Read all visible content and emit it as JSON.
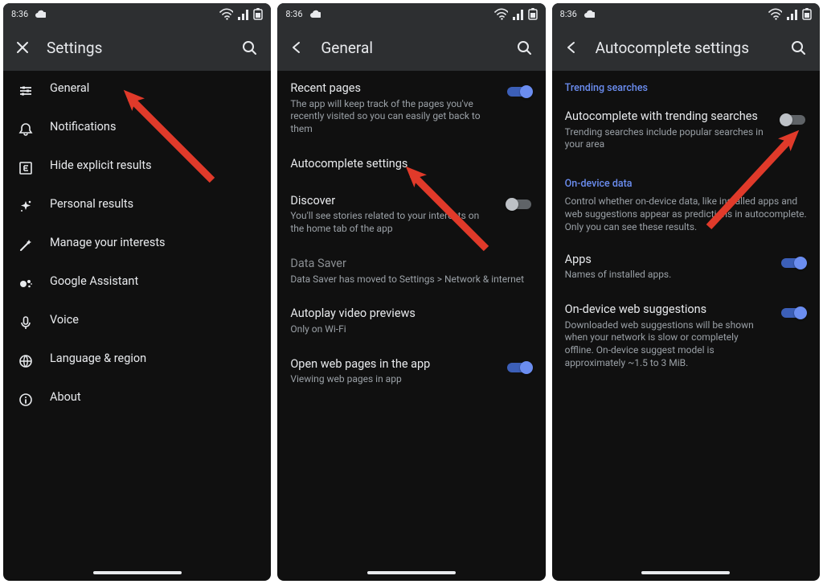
{
  "status": {
    "time": "8:36"
  },
  "screen1": {
    "title": "Settings",
    "items": [
      {
        "icon": "sliders",
        "label": "General"
      },
      {
        "icon": "bell",
        "label": "Notifications"
      },
      {
        "icon": "explicit",
        "label": "Hide explicit results"
      },
      {
        "icon": "sparkle",
        "label": "Personal results"
      },
      {
        "icon": "wand",
        "label": "Manage your interests"
      },
      {
        "icon": "assistant",
        "label": "Google Assistant"
      },
      {
        "icon": "mic",
        "label": "Voice"
      },
      {
        "icon": "globe",
        "label": "Language & region"
      },
      {
        "icon": "info",
        "label": "About"
      }
    ]
  },
  "screen2": {
    "title": "General",
    "items": {
      "recent": {
        "title": "Recent pages",
        "sub": "The app will keep track of the pages you've recently visited so you can easily get back to them",
        "toggle": true
      },
      "autoc": {
        "title": "Autocomplete settings"
      },
      "discover": {
        "title": "Discover",
        "sub": "You'll see stories related to your interests on the home tab of the app",
        "toggle": false
      },
      "datasaver": {
        "title": "Data Saver",
        "sub": "Data Saver has moved to Settings > Network & internet",
        "disabled": true
      },
      "autoplay": {
        "title": "Autoplay video previews",
        "sub": "Only on Wi-Fi"
      },
      "openweb": {
        "title": "Open web pages in the app",
        "sub": "Viewing web pages in app",
        "toggle": true
      }
    }
  },
  "screen3": {
    "title": "Autocomplete settings",
    "trending_header": "Trending searches",
    "trending": {
      "title": "Autocomplete with trending searches",
      "sub": "Trending searches include popular searches in your area",
      "toggle": false
    },
    "ondevice_header": "On-device data",
    "ondevice_sub": "Control whether on-device data, like installed apps and web suggestions appear as predictions in autocomplete. Only you can see these results.",
    "apps": {
      "title": "Apps",
      "sub": "Names of installed apps.",
      "toggle": true
    },
    "websug": {
      "title": "On-device web suggestions",
      "sub": "Downloaded web suggestions will be shown when your network is slow or completely offline. On-device suggest model is approximately ~1.5 to 3 MiB.",
      "toggle": true
    }
  }
}
